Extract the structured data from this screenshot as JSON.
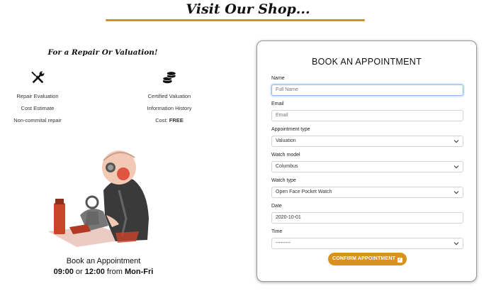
{
  "header": {
    "title": "Visit Our Shop..."
  },
  "left": {
    "heading": "For a Repair Or Valuation!",
    "repair_col": {
      "icon": "wrench-screwdriver-icon",
      "items": [
        "Repair Evaluation",
        "Cost Estimate",
        "Non-commital repair"
      ]
    },
    "valuation_col": {
      "icon": "coins-stack-icon",
      "items": [
        "Certified Valuation",
        "Information History"
      ],
      "cost_label": "Cost: ",
      "cost_value": "FREE"
    },
    "illustration": "watchmaker-illustration",
    "book_caption": "Book an Appointment",
    "hours": {
      "start": "09:00",
      "sep": " or ",
      "end": "12:00",
      "from": " from ",
      "days": "Mon-Fri"
    }
  },
  "form": {
    "title": "BOOK AN APPOINTMENT",
    "name": {
      "label": "Name",
      "placeholder": "Full Name"
    },
    "email": {
      "label": "Email",
      "placeholder": "Email"
    },
    "appointment_type": {
      "label": "Appointment type",
      "value": "Valuation"
    },
    "watch_model": {
      "label": "Watch model",
      "value": "Columbus"
    },
    "watch_type": {
      "label": "Watch type",
      "value": "Open Face Pocket Watch"
    },
    "date": {
      "label": "Date",
      "value": "2020-10-01"
    },
    "time": {
      "label": "Time",
      "value": "---------"
    },
    "submit_label": "CONFIRM APPOINTMENT",
    "submit_icon": "check-square-icon"
  },
  "colors": {
    "accent": "#d9921d",
    "focus": "#86b7fe"
  }
}
